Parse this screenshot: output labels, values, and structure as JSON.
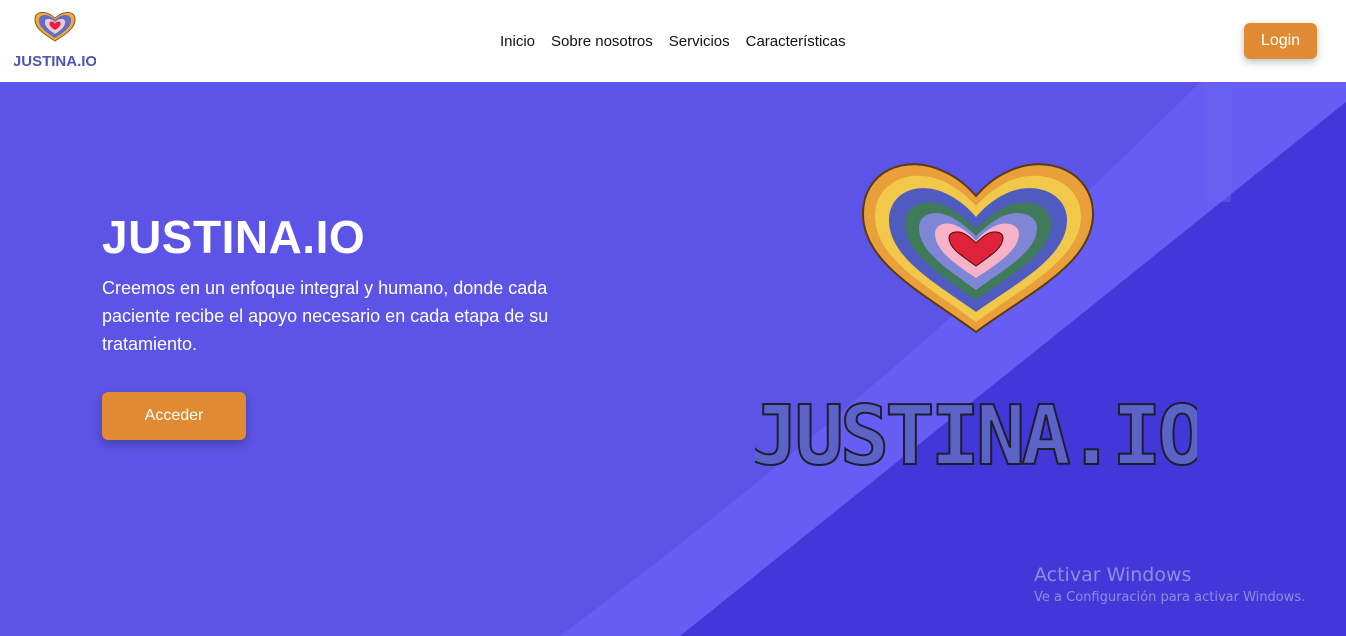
{
  "header": {
    "logo_text": "JUSTINA.IO",
    "nav": [
      "Inicio",
      "Sobre nosotros",
      "Servicios",
      "Características"
    ],
    "login_label": "Login"
  },
  "hero": {
    "title": "JUSTINA.IO",
    "description": "Creemos en un enfoque integral y humano, donde cada paciente recibe el apoyo necesario en cada etapa de su tratamiento.",
    "cta_label": "Acceder",
    "art_text": "JUSTINA.IO"
  },
  "windows_watermark": {
    "title": "Activar Windows",
    "subtitle": "Ve a Configuración para activar Windows."
  },
  "colors": {
    "hero_bg": "#5b54e6",
    "accent": "#e08a33",
    "letters": [
      "#5b63c9",
      "#7bbde0",
      "#8ed0c0",
      "#f26b8a",
      "#3f7a5b",
      "#8a86c9",
      "#e9a03b",
      "#f2c84b",
      "#4a58b5",
      "#f25c8a"
    ]
  }
}
